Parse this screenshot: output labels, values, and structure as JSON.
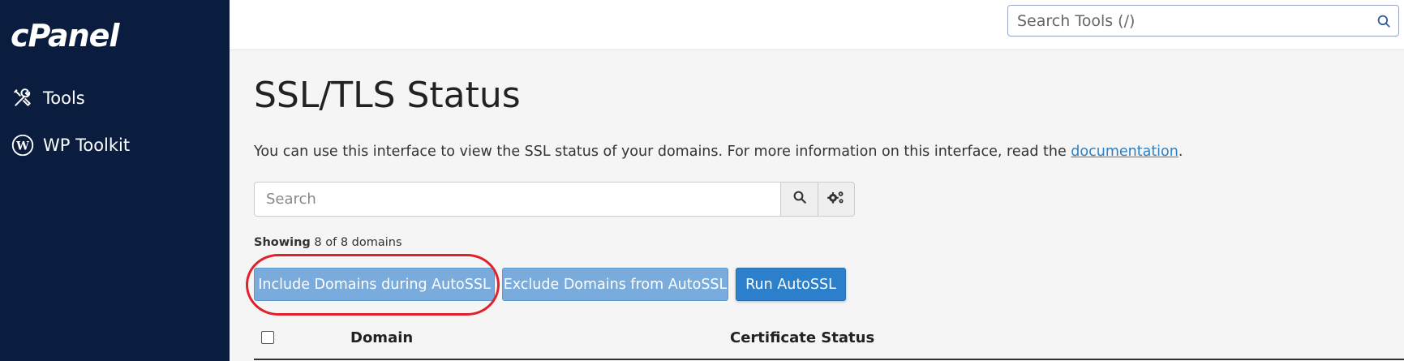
{
  "sidebar": {
    "logo": "cPanel",
    "items": [
      {
        "label": "Tools",
        "icon": "tools-icon"
      },
      {
        "label": "WP Toolkit",
        "icon": "wordpress-icon"
      }
    ]
  },
  "topbar": {
    "search_placeholder": "Search Tools (/)"
  },
  "page": {
    "title": "SSL/TLS Status",
    "intro_text": "You can use this interface to view the SSL status of your domains. For more information on this interface, read the ",
    "intro_link": "documentation",
    "intro_end": ".",
    "search_placeholder": "Search",
    "showing_label": "Showing",
    "showing_count": "8 of 8 domains",
    "buttons": {
      "include": "Include Domains during AutoSSL",
      "exclude": "Exclude Domains from AutoSSL",
      "run": "Run AutoSSL"
    },
    "table": {
      "columns": [
        "Domain",
        "Certificate Status"
      ]
    }
  },
  "colors": {
    "sidebar_bg": "#0b1d3f",
    "primary": "#2c7fcb",
    "light_button": "#79acdc",
    "highlight": "#e0202a",
    "link": "#2d7fc1"
  }
}
